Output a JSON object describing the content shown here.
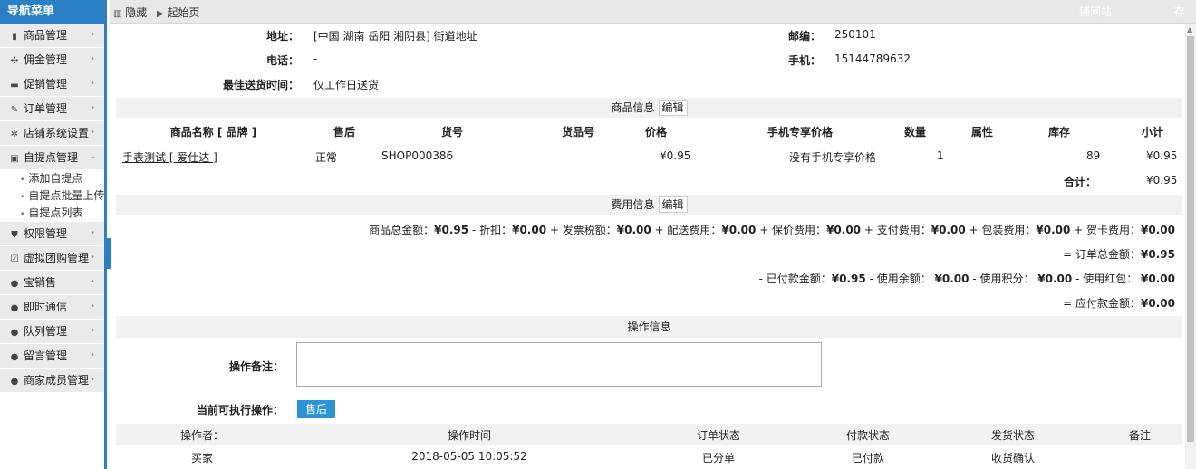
{
  "nav": {
    "title": "导航菜单",
    "items": [
      {
        "label": "商品管理",
        "icon": "phone-icon",
        "glyph": "▮"
      },
      {
        "label": "佣金管理",
        "icon": "network-icon",
        "glyph": "✣"
      },
      {
        "label": "促销管理",
        "icon": "cart-icon",
        "glyph": "▬"
      },
      {
        "label": "订单管理",
        "icon": "edit-icon",
        "glyph": "✎"
      },
      {
        "label": "店铺系统设置",
        "icon": "gears-icon",
        "glyph": "✲"
      },
      {
        "label": "自提点管理",
        "icon": "book-icon",
        "glyph": "▣"
      }
    ],
    "sub_items": [
      "添加自提点",
      "自提点批量上传",
      "自提点列表"
    ],
    "items_after": [
      {
        "label": "权限管理",
        "icon": "shield-icon",
        "glyph": "⛊"
      },
      {
        "label": "虚拟团购管理",
        "icon": "check-icon",
        "glyph": "☑"
      },
      {
        "label": "宝销售",
        "icon": "chat-icon",
        "glyph": "●"
      },
      {
        "label": "即时通信",
        "icon": "chat-icon",
        "glyph": "●"
      },
      {
        "label": "队列管理",
        "icon": "chat-icon",
        "glyph": "●"
      },
      {
        "label": "留言管理",
        "icon": "chat-icon",
        "glyph": "●"
      },
      {
        "label": "商家成员管理",
        "icon": "chat-icon",
        "glyph": "●"
      }
    ]
  },
  "topbar": {
    "hide_label": "隐藏",
    "home_label": "起始页",
    "right_text_1": "铺网站",
    "right_text_2": "存"
  },
  "address": {
    "addr_label": "地址：",
    "addr_value": "[中国 湖南 岳阳 湘阴县] 街道地址",
    "zip_label": "邮编：",
    "zip_value": "250101",
    "phone_label": "电话：",
    "phone_value": "-",
    "mobile_label": "手机：",
    "mobile_value": "15144789632",
    "best_time_label": "最佳送货时间：",
    "best_time_value": "仅工作日送货"
  },
  "goods": {
    "section_title": "商品信息",
    "edit_label": "编辑",
    "headers": [
      "商品名称 [ 品牌 ]",
      "售后",
      "货号",
      "货品号",
      "价格",
      "手机专享价格",
      "数量",
      "属性",
      "库存",
      "小计"
    ],
    "row": {
      "name": "手表测试 [ 爱仕达 ]",
      "after_sale": "正常",
      "sku": "SHOP000386",
      "product_no": "",
      "price": "¥0.95",
      "mobile_price": "没有手机专享价格",
      "qty": "1",
      "attr": "",
      "stock": "89",
      "subtotal": "¥0.95"
    },
    "total_label": "合计：",
    "total_value": "¥0.95"
  },
  "fees": {
    "section_title": "费用信息",
    "edit_label": "编辑",
    "line1_parts": [
      {
        "t": "商品总金额：",
        "b": false
      },
      {
        "t": "¥0.95",
        "b": true
      },
      {
        "t": " - 折扣：",
        "b": false
      },
      {
        "t": "¥0.00",
        "b": true
      },
      {
        "t": " + 发票税额：",
        "b": false
      },
      {
        "t": "¥0.00",
        "b": true
      },
      {
        "t": " + 配送费用：",
        "b": false
      },
      {
        "t": "¥0.00",
        "b": true
      },
      {
        "t": " + 保价费用：",
        "b": false
      },
      {
        "t": "¥0.00",
        "b": true
      },
      {
        "t": " + 支付费用：",
        "b": false
      },
      {
        "t": "¥0.00",
        "b": true
      },
      {
        "t": " + 包装费用：",
        "b": false
      },
      {
        "t": "¥0.00",
        "b": true
      },
      {
        "t": " + 贺卡费用：",
        "b": false
      },
      {
        "t": "¥0.00",
        "b": true
      }
    ],
    "line2_parts": [
      {
        "t": "= 订单总金额：",
        "b": false
      },
      {
        "t": "¥0.95",
        "b": true
      }
    ],
    "line3_parts": [
      {
        "t": "- 已付款金额：",
        "b": false
      },
      {
        "t": "¥0.95",
        "b": true
      },
      {
        "t": " - 使用余额： ",
        "b": false
      },
      {
        "t": "¥0.00",
        "b": true
      },
      {
        "t": " - 使用积分： ",
        "b": false
      },
      {
        "t": "¥0.00",
        "b": true
      },
      {
        "t": " - 使用红包： ",
        "b": false
      },
      {
        "t": "¥0.00",
        "b": true
      }
    ],
    "line4_parts": [
      {
        "t": "= 应付款金额：",
        "b": false
      },
      {
        "t": "¥0.00",
        "b": true
      }
    ]
  },
  "ops": {
    "section_title": "操作信息",
    "note_label": "操作备注：",
    "note_value": "",
    "current_ops_label": "当前可执行操作：",
    "after_sale_button": "售后",
    "log_headers": [
      "操作者：",
      "操作时间",
      "订单状态",
      "付款状态",
      "发货状态",
      "备注"
    ],
    "log_row": [
      "买家",
      "2018-05-05 10:05:52",
      "已分单",
      "已付款",
      "收货确认",
      ""
    ]
  }
}
